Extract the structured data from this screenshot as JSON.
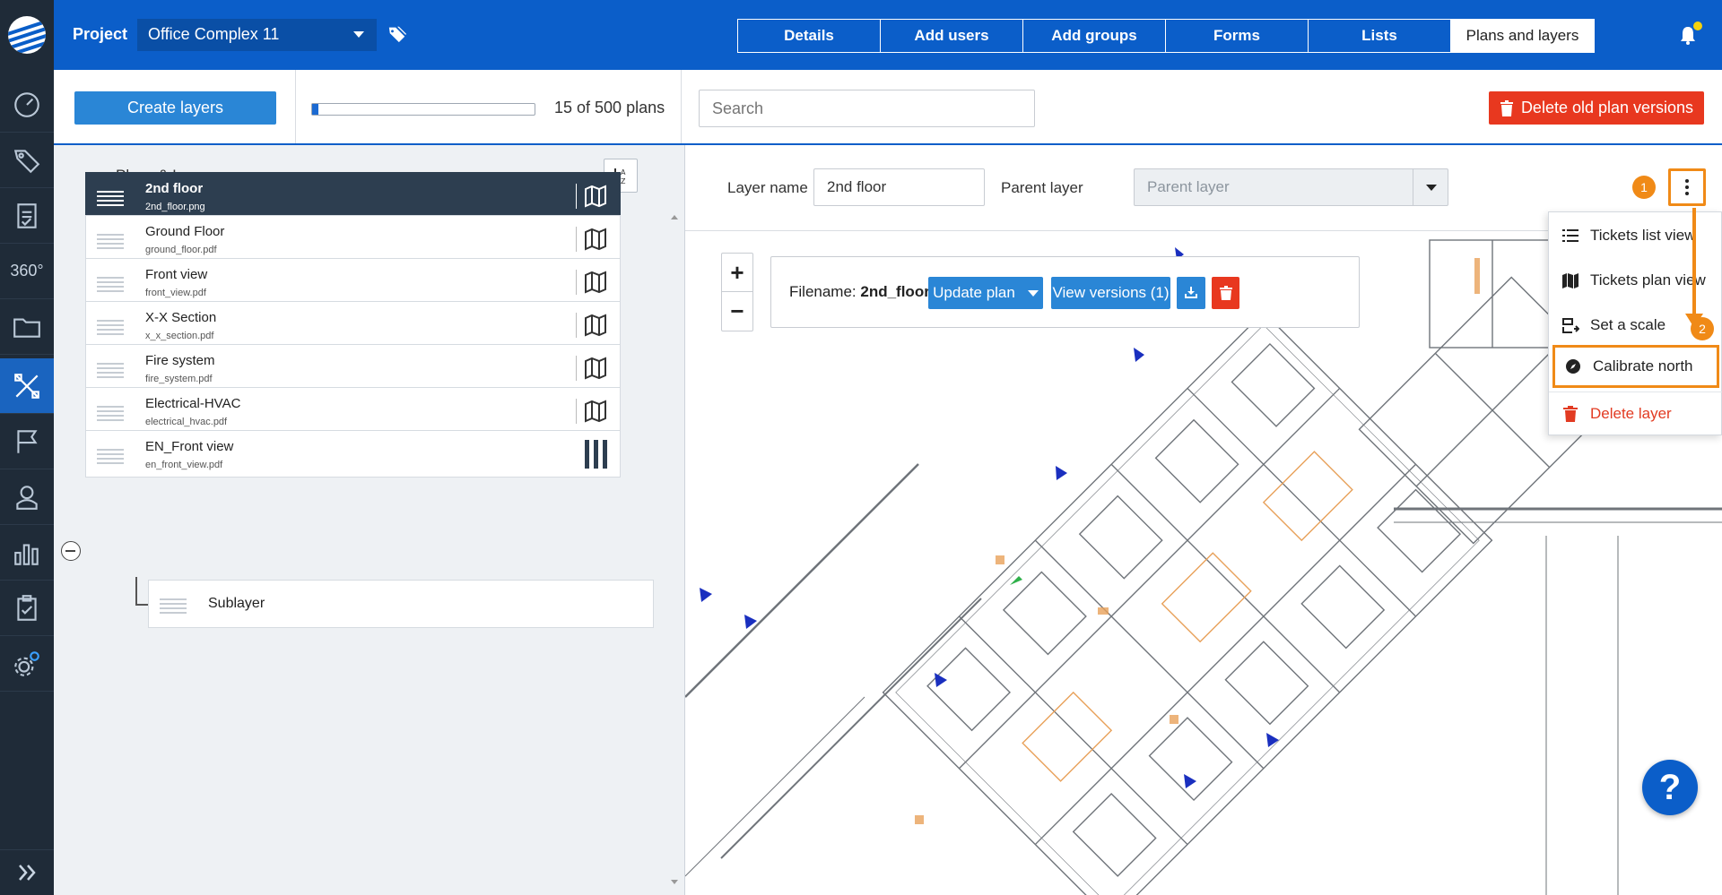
{
  "topbar": {
    "project_label": "Project",
    "project_value": "Office Complex 11",
    "tabs": [
      "Details",
      "Add users",
      "Add groups",
      "Forms",
      "Lists",
      "Plans and layers"
    ],
    "active_tab": "Plans and layers"
  },
  "rail": {
    "items": [
      "dashboard-icon",
      "tags-icon",
      "forms-icon",
      "360",
      "folder-icon",
      "plans-icon",
      "flag-icon",
      "user-icon",
      "stats-icon",
      "clipboard-icon",
      "settings-icon"
    ],
    "label_360": "360°"
  },
  "toolbar": {
    "create_label": "Create layers",
    "progress_current": 15,
    "progress_total": 500,
    "progress_text": "15 of 500 plans",
    "search_placeholder": "Search",
    "delete_old_label": "Delete old plan versions"
  },
  "plans": {
    "title": "Plans & Layers",
    "rows": [
      {
        "name": "2nd floor",
        "file": "2nd_floor.png",
        "selected": true
      },
      {
        "name": "Ground Floor",
        "file": "ground_floor.pdf"
      },
      {
        "name": "Front view",
        "file": "front_view.pdf"
      },
      {
        "name": "X-X Section",
        "file": "x_x_section.pdf"
      },
      {
        "name": "Fire system",
        "file": "fire_system.pdf"
      },
      {
        "name": "Electrical-HVAC",
        "file": "electrical_hvac.pdf"
      },
      {
        "name": "EN_Front view",
        "file": "en_front_view.pdf"
      }
    ],
    "sublayer": "Sublayer"
  },
  "layer_form": {
    "layer_name_label": "Layer name",
    "layer_name_value": "2nd floor",
    "parent_label": "Parent layer",
    "parent_placeholder": "Parent layer"
  },
  "filebox": {
    "filename_label": "Filename:",
    "filename_value": "2nd_floor.png",
    "update_label": "Update plan",
    "versions_label": "View versions (1)"
  },
  "menu": {
    "items": [
      "Tickets list view",
      "Tickets plan view",
      "Set a scale",
      "Calibrate north",
      "Delete layer"
    ]
  },
  "annotations": {
    "badge1": "1",
    "badge2": "2"
  },
  "help_label": "?",
  "colors": {
    "brand": "#0b5ec9",
    "accent": "#2a86d6",
    "danger": "#e8381f",
    "highlight": "#f08a17",
    "rail": "#1f2b38"
  }
}
